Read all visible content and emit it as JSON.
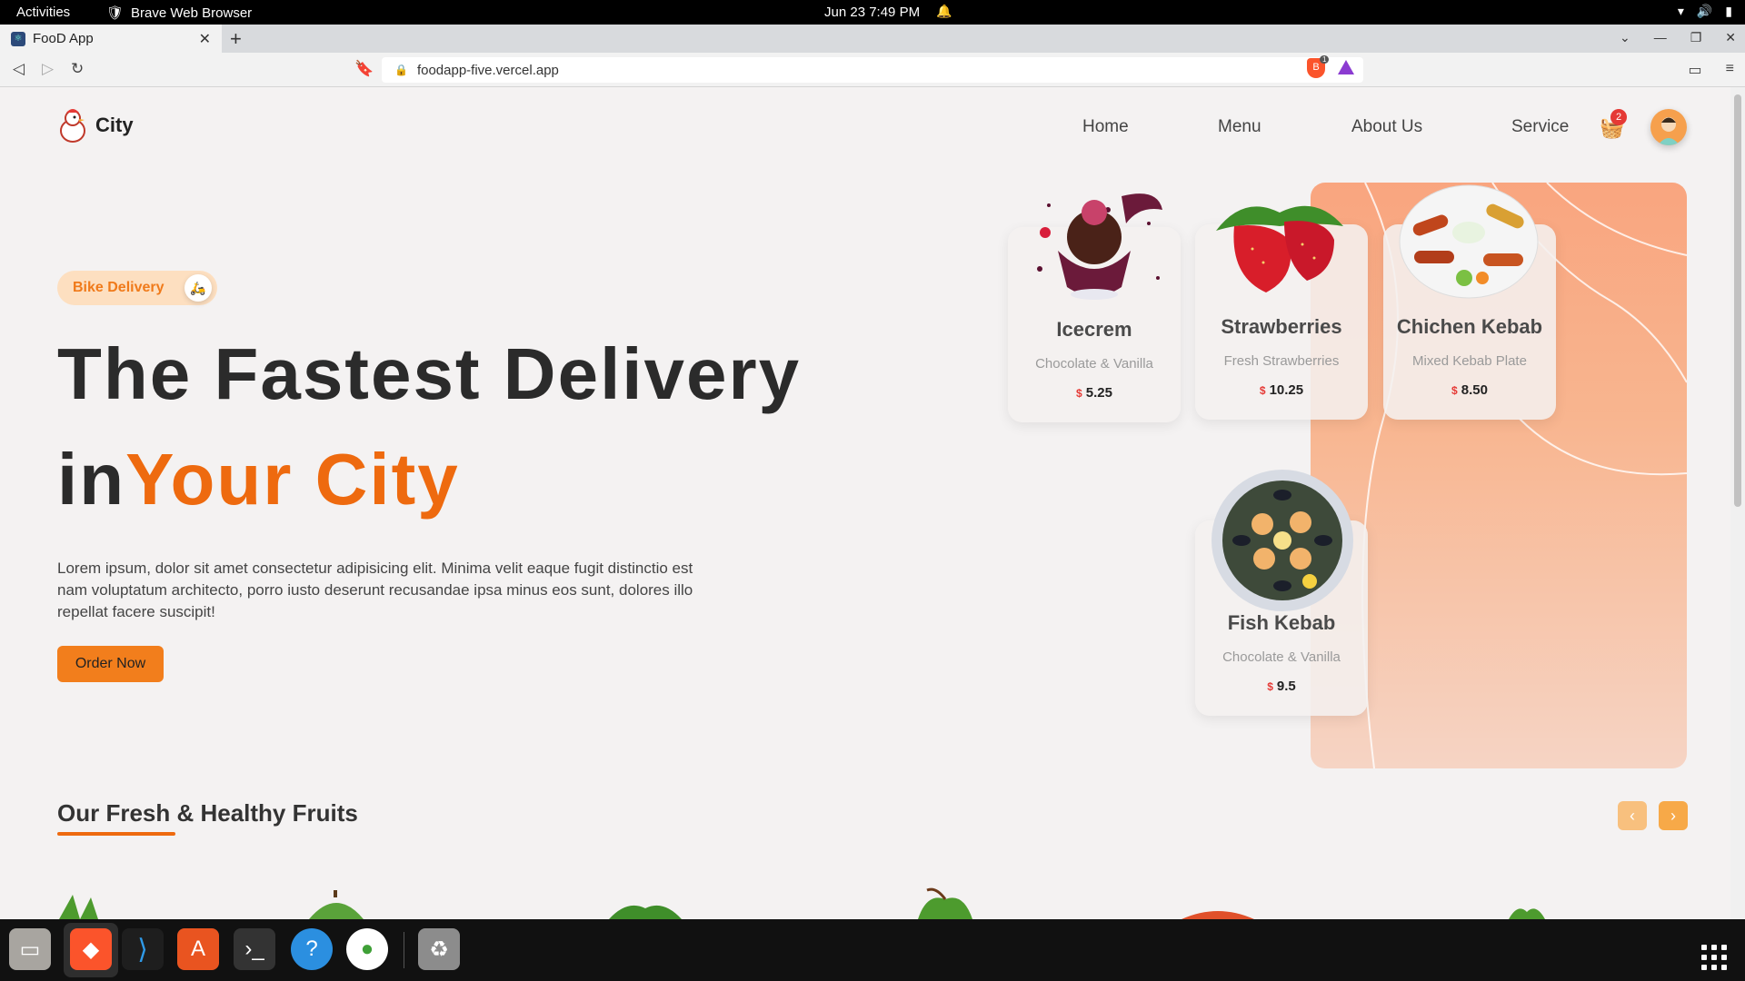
{
  "topbar": {
    "activities": "Activities",
    "app_name": "Brave Web Browser",
    "clock": "Jun 23  7:49 PM"
  },
  "browser": {
    "tab_title": "FooD App",
    "url": "foodapp-five.vercel.app",
    "shield_count": "1"
  },
  "site": {
    "brand": "City",
    "nav": [
      "Home",
      "Menu",
      "About Us",
      "Service"
    ],
    "cart_count": "2"
  },
  "hero": {
    "pill": "Bike Delivery",
    "headline_line1": "The Fastest Delivery",
    "headline_in": "in",
    "headline_accent": "Your City",
    "lorem": "Lorem ipsum, dolor sit amet consectetur adipisicing elit. Minima velit eaque fugit distinctio est nam voluptatum architecto, porro iusto deserunt recusandae ipsa minus eos sunt, dolores illo repellat facere suscipit!",
    "cta": "Order Now"
  },
  "cards": [
    {
      "name": "Icecrem",
      "desc": "Chocolate & Vanilla",
      "currency": "$",
      "price": "5.25"
    },
    {
      "name": "Strawberries",
      "desc": "Fresh Strawberries",
      "currency": "$",
      "price": "10.25"
    },
    {
      "name": "Chichen Kebab",
      "desc": "Mixed Kebab Plate",
      "currency": "$",
      "price": "8.50"
    },
    {
      "name": "Fish Kebab",
      "desc": "Chocolate & Vanilla",
      "currency": "$",
      "price": "9.5"
    }
  ],
  "section": {
    "title": "Our Fresh & Healthy Fruits",
    "prev": "‹",
    "next": "›"
  },
  "colors": {
    "accent": "#ee6a0f",
    "button": "#f27e1c",
    "hero_panel": "#f9a57f",
    "badge_red": "#e53935"
  }
}
